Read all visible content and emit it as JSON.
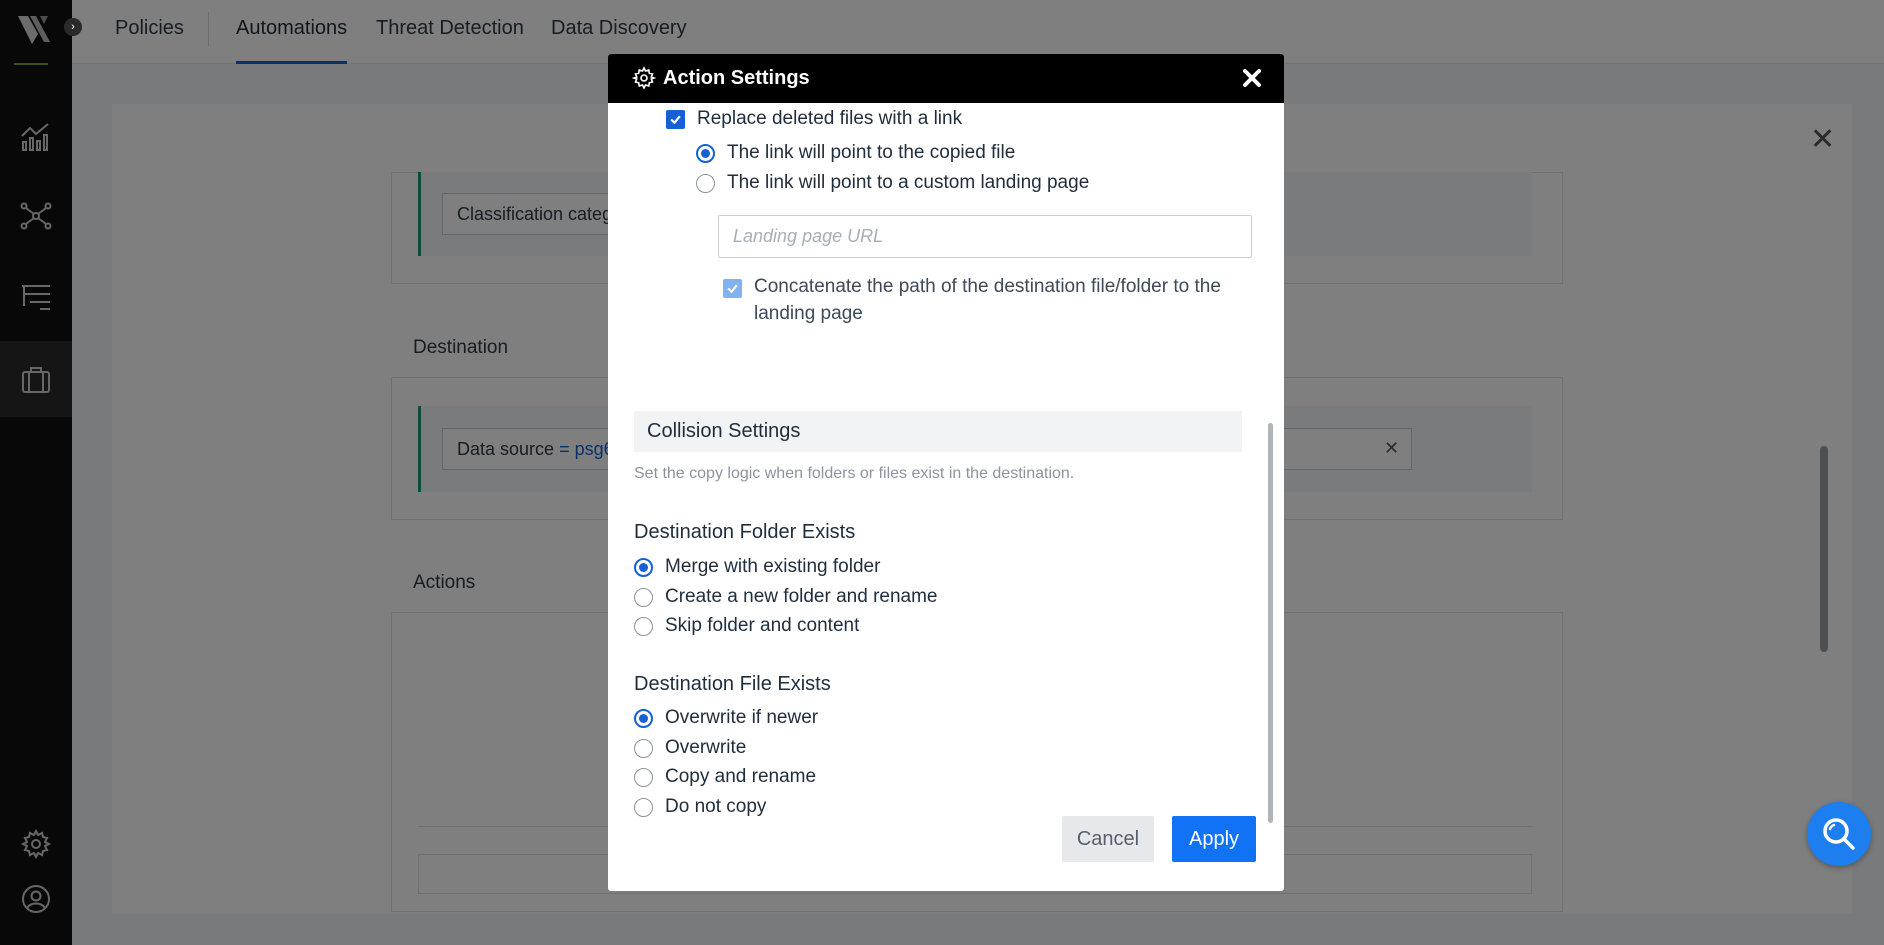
{
  "nav": {
    "tabs": [
      {
        "label": "Policies"
      },
      {
        "label": "Automations"
      },
      {
        "label": "Threat Detection"
      },
      {
        "label": "Data Discovery"
      }
    ],
    "active_tab": "Automations"
  },
  "sidebar": {
    "icons": [
      "logo-icon",
      "analytics-icon",
      "network-icon",
      "filter-list-icon",
      "briefcase-icon",
      "settings-icon",
      "user-icon"
    ]
  },
  "background": {
    "classification_field": "Classification categ",
    "destination_label": "Destination",
    "data_source_label": "Data source",
    "data_source_value": "= psg6",
    "actions_label": "Actions"
  },
  "modal": {
    "title": "Action Settings",
    "replace_deleted": {
      "label": "Replace deleted files with a link",
      "checked": true
    },
    "link_options": [
      {
        "label": "The link will point to the copied file",
        "selected": true
      },
      {
        "label": "The link will point to a custom landing page",
        "selected": false
      }
    ],
    "landing_url": {
      "value": "",
      "placeholder": "Landing page URL"
    },
    "concatenate": {
      "label": "Concatenate the path of the destination file/folder to the landing page",
      "checked": true
    },
    "collision": {
      "title": "Collision Settings",
      "hint": "Set the copy logic when folders or files exist in the destination."
    },
    "folder_exists": {
      "title": "Destination Folder Exists",
      "options": [
        {
          "label": "Merge with existing folder",
          "selected": true
        },
        {
          "label": "Create a new folder and rename",
          "selected": false
        },
        {
          "label": "Skip folder and content",
          "selected": false
        }
      ]
    },
    "file_exists": {
      "title": "Destination File Exists",
      "options": [
        {
          "label": "Overwrite if newer",
          "selected": true
        },
        {
          "label": "Overwrite",
          "selected": false
        },
        {
          "label": "Copy and rename",
          "selected": false
        },
        {
          "label": "Do not copy",
          "selected": false
        }
      ]
    },
    "buttons": {
      "cancel": "Cancel",
      "apply": "Apply"
    }
  },
  "colors": {
    "accent": "#1560d4",
    "apply": "#1272f5",
    "header": "#000000",
    "sidebar": "#101010"
  }
}
